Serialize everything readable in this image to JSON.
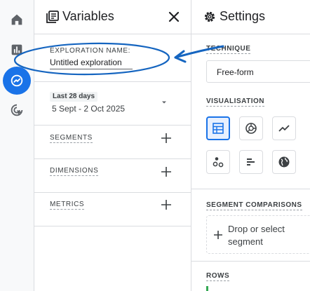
{
  "variables_panel": {
    "title": "Variables",
    "exploration_name_label": "EXPLORATION NAME:",
    "exploration_name_value": "Untitled exploration",
    "date_badge": "Last 28 days",
    "date_range": "5 Sept - 2 Oct 2025",
    "segments_label": "SEGMENTS",
    "dimensions_label": "DIMENSIONS",
    "metrics_label": "METRICS"
  },
  "settings_panel": {
    "title": "Settings",
    "technique_label": "TECHNIQUE",
    "technique_value": "Free-form",
    "visualisation_label": "VISUALISATION",
    "segment_comparisons_label": "SEGMENT COMPARISONS",
    "drop_segment_text": "Drop or select segment",
    "rows_label": "ROWS"
  },
  "nav_icons": [
    "home-icon",
    "reports-icon",
    "explore-icon",
    "advertising-icon"
  ],
  "visualisation_icons": [
    "table-icon",
    "donut-chart-icon",
    "line-chart-icon",
    "scatter-plot-icon",
    "bar-chart-icon",
    "geo-map-icon"
  ],
  "colors": {
    "accent": "#1a73e8",
    "annotation": "#1565c0",
    "divider": "#dadce0"
  }
}
